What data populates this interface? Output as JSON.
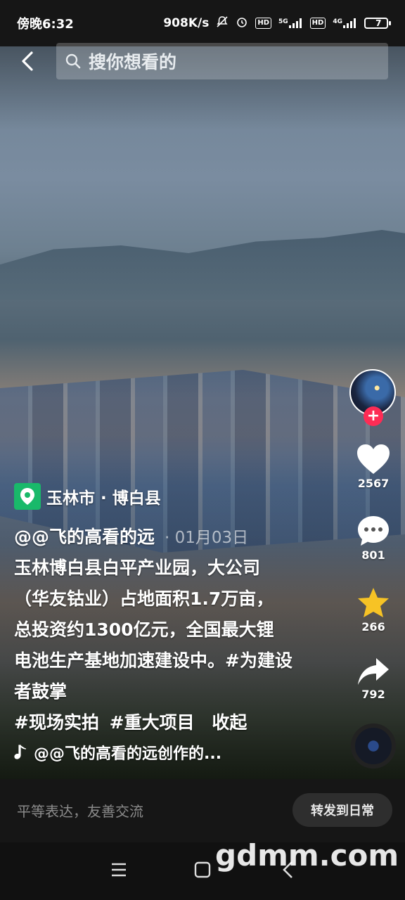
{
  "status_bar": {
    "time": "傍晚6:32",
    "speed": "908K/s",
    "net1": "5G",
    "net2": "4G",
    "hd": "HD",
    "battery": "7"
  },
  "search": {
    "placeholder": "搜你想看的"
  },
  "actions": {
    "likes": "2567",
    "comments": "801",
    "favorites": "266",
    "shares": "792"
  },
  "location": {
    "text": "玉林市 · 博白县"
  },
  "post": {
    "author": "@@飞的高看的远",
    "date": "· 01月03日",
    "desc_lines": [
      "玉林博白县白平产业园，大公司",
      "（华友钴业）占地面积1.7万亩，",
      "总投资约1300亿元，全国最大锂",
      "电池生产基地加速建设中。"
    ],
    "hashtags": [
      "#为建设者鼓掌",
      "#现场实拍",
      "#重大项目"
    ],
    "collapse": "收起",
    "music": "@@飞的高看的远创作的..."
  },
  "bottom": {
    "comment_placeholder": "平等表达，友善交流",
    "repost_label": "转发到日常"
  },
  "watermark": "gdmm.com",
  "colors": {
    "accent_red": "#fe2c55",
    "location_green": "#19b96a",
    "star_yellow": "#f7c325"
  }
}
